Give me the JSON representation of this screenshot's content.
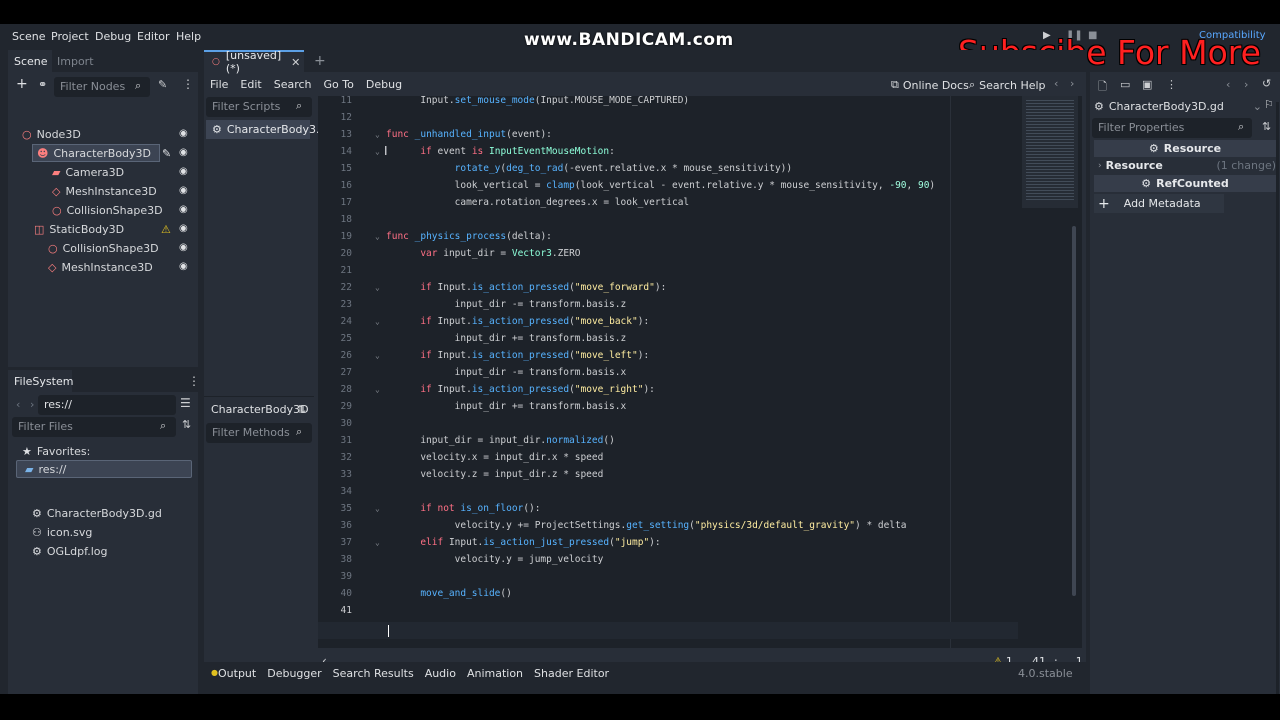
{
  "menu": {
    "scene": "Scene",
    "project": "Project",
    "debug": "Debug",
    "editor": "Editor",
    "help": "Help",
    "renderer": "Compatibility"
  },
  "watermark": {
    "bandicam": "www.BANDICAM.com",
    "subscribe": "Subscibe For More"
  },
  "scene_dock": {
    "tab_scene": "Scene",
    "tab_import": "Import",
    "filter_placeholder": "Filter Nodes",
    "nodes": [
      {
        "label": "Node3D",
        "color": "#fc7f7f"
      },
      {
        "label": "CharacterBody3D",
        "color": "#fc7f7f"
      },
      {
        "label": "Camera3D",
        "color": "#fc7f7f"
      },
      {
        "label": "MeshInstance3D",
        "color": "#fc7f7f"
      },
      {
        "label": "CollisionShape3D",
        "color": "#fc7f7f"
      },
      {
        "label": "StaticBody3D",
        "color": "#fc7f7f"
      },
      {
        "label": "CollisionShape3D",
        "color": "#fc7f7f"
      },
      {
        "label": "MeshInstance3D",
        "color": "#fc7f7f"
      }
    ]
  },
  "filesystem": {
    "title": "FileSystem",
    "path": "res://",
    "filter_placeholder": "Filter Files",
    "favorites": "Favorites:",
    "root": "res://",
    "files": [
      "CharacterBody3D.gd",
      "icon.svg",
      "OGLdpf.log"
    ]
  },
  "script_editor": {
    "tab_label": "[unsaved](*)",
    "menu": {
      "file": "File",
      "edit": "Edit",
      "search": "Search",
      "goto": "Go To",
      "debug": "Debug"
    },
    "online_docs": "Online Docs",
    "search_help": "Search Help",
    "filter_scripts": "Filter Scripts",
    "script_item": "CharacterBody3...",
    "methods_title": "CharacterBody3D",
    "filter_methods": "Filter Methods",
    "warnings": "1",
    "line": "41",
    "col": "1",
    "lines": [
      {
        "n": "11",
        "html": "<span class='pl'>\tInput.</span><span class='fn'>set_mouse_mode</span><span class='pl'>(Input.MOUSE_MODE_CAPTURED)</span>"
      },
      {
        "n": "12",
        "html": ""
      },
      {
        "n": "13",
        "html": "<span class='kw'>func</span><span class='pl'> </span><span class='fn'>_unhandled_input</span><span class='pl'>(event):</span>"
      },
      {
        "n": "14",
        "html": "<span class='pl'>\t</span><span class='kw'>if</span><span class='pl'> event </span><span class='kw'>is</span><span class='pl'> </span><span class='ty'>InputEventMouseMotion</span><span class='pl'>:</span>"
      },
      {
        "n": "15",
        "html": "<span class='pl'>\t\t</span><span class='fn'>rotate_y</span><span class='pl'>(</span><span class='fn'>deg_to_rad</span><span class='pl'>(-event.relative.x * mouse_sensitivity))</span>"
      },
      {
        "n": "16",
        "html": "<span class='pl'>\t\tlook_vertical = </span><span class='fn'>clamp</span><span class='pl'>(look_vertical - event.relative.y * mouse_sensitivity, </span><span class='nm'>-90</span><span class='pl'>, </span><span class='nm'>90</span><span class='pl'>)</span>"
      },
      {
        "n": "17",
        "html": "<span class='pl'>\t\tcamera.rotation_degrees.x = look_vertical</span>"
      },
      {
        "n": "18",
        "html": ""
      },
      {
        "n": "19",
        "html": "<span class='kw'>func</span><span class='pl'> </span><span class='fn'>_physics_process</span><span class='pl'>(delta):</span>"
      },
      {
        "n": "20",
        "html": "<span class='pl'>\t</span><span class='kw'>var</span><span class='pl'> input_dir = </span><span class='ty'>Vector3</span><span class='pl'>.ZERO</span>"
      },
      {
        "n": "21",
        "html": ""
      },
      {
        "n": "22",
        "html": "<span class='pl'>\t</span><span class='kw'>if</span><span class='pl'> Input.</span><span class='fn'>is_action_pressed</span><span class='pl'>(</span><span class='st'>\"move_forward\"</span><span class='pl'>):</span>"
      },
      {
        "n": "23",
        "html": "<span class='pl'>\t\tinput_dir -= transform.basis.z</span>"
      },
      {
        "n": "24",
        "html": "<span class='pl'>\t</span><span class='kw'>if</span><span class='pl'> Input.</span><span class='fn'>is_action_pressed</span><span class='pl'>(</span><span class='st'>\"move_back\"</span><span class='pl'>):</span>"
      },
      {
        "n": "25",
        "html": "<span class='pl'>\t\tinput_dir += transform.basis.z</span>"
      },
      {
        "n": "26",
        "html": "<span class='pl'>\t</span><span class='kw'>if</span><span class='pl'> Input.</span><span class='fn'>is_action_pressed</span><span class='pl'>(</span><span class='st'>\"move_left\"</span><span class='pl'>):</span>"
      },
      {
        "n": "27",
        "html": "<span class='pl'>\t\tinput_dir -= transform.basis.x</span>"
      },
      {
        "n": "28",
        "html": "<span class='pl'>\t</span><span class='kw'>if</span><span class='pl'> Input.</span><span class='fn'>is_action_pressed</span><span class='pl'>(</span><span class='st'>\"move_right\"</span><span class='pl'>):</span>"
      },
      {
        "n": "29",
        "html": "<span class='pl'>\t\tinput_dir += transform.basis.x</span>"
      },
      {
        "n": "30",
        "html": ""
      },
      {
        "n": "31",
        "html": "<span class='pl'>\tinput_dir = input_dir.</span><span class='fn'>normalized</span><span class='pl'>()</span>"
      },
      {
        "n": "32",
        "html": "<span class='pl'>\tvelocity.x = input_dir.x * speed</span>"
      },
      {
        "n": "33",
        "html": "<span class='pl'>\tvelocity.z = input_dir.z * speed</span>"
      },
      {
        "n": "34",
        "html": ""
      },
      {
        "n": "35",
        "html": "<span class='pl'>\t</span><span class='kw'>if not</span><span class='pl'> </span><span class='fn'>is_on_floor</span><span class='pl'>():</span>"
      },
      {
        "n": "36",
        "html": "<span class='pl'>\t\tvelocity.y += ProjectSettings.</span><span class='fn'>get_setting</span><span class='pl'>(</span><span class='st'>\"physics/3d/default_gravity\"</span><span class='pl'>) * delta</span>"
      },
      {
        "n": "37",
        "html": "<span class='pl'>\t</span><span class='kw'>elif</span><span class='pl'> Input.</span><span class='fn'>is_action_just_pressed</span><span class='pl'>(</span><span class='st'>\"jump\"</span><span class='pl'>):</span>"
      },
      {
        "n": "38",
        "html": "<span class='pl'>\t\tvelocity.y = jump_velocity</span>"
      },
      {
        "n": "39",
        "html": ""
      },
      {
        "n": "40",
        "html": "<span class='pl'>\t</span><span class='fn'>move_and_slide</span><span class='pl'>()</span>"
      },
      {
        "n": "41",
        "html": ""
      }
    ]
  },
  "bottom_tabs": [
    "Output",
    "Debugger",
    "Search Results",
    "Audio",
    "Animation",
    "Shader Editor"
  ],
  "version": "4.0.stable",
  "inspector": {
    "file": "CharacterBody3D.gd",
    "filter_placeholder": "Filter Properties",
    "resource_header": "Resource",
    "resource_label": "Resource",
    "changes": "(1 change)",
    "refcounted": "RefCounted",
    "add_metadata": "Add Metadata"
  }
}
